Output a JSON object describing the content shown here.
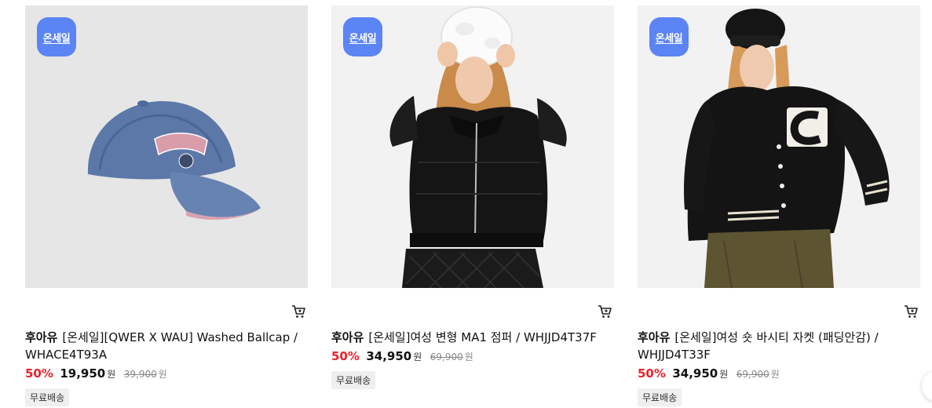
{
  "badge_label": "온세일",
  "products": [
    {
      "brand": "후아유",
      "name": "[온세일][QWER X WAU] Washed Ballcap / WHACE4T93A",
      "discount": "50%",
      "price": "19,950",
      "price_unit": "원",
      "original_price": "39,900",
      "original_unit": "원",
      "shipping": "무료배송"
    },
    {
      "brand": "후아유",
      "name": "[온세일]여성 변형 MA1 점퍼 / WHJJD4T37F",
      "discount": "50%",
      "price": "34,950",
      "price_unit": "원",
      "original_price": "69,900",
      "original_unit": "원",
      "shipping": "무료배송"
    },
    {
      "brand": "후아유",
      "name": "[온세일]여성 숏 바시티 자켓 (패딩안감) / WHJJD4T33F",
      "discount": "50%",
      "price": "34,950",
      "price_unit": "원",
      "original_price": "69,900",
      "original_unit": "원",
      "shipping": "무료배송"
    }
  ],
  "colors": {
    "badge": "#5b84f4",
    "discount": "#e8242b",
    "thumb_bg_cap": "#e6e6e6",
    "thumb_bg_model": "#f2f2f2"
  }
}
